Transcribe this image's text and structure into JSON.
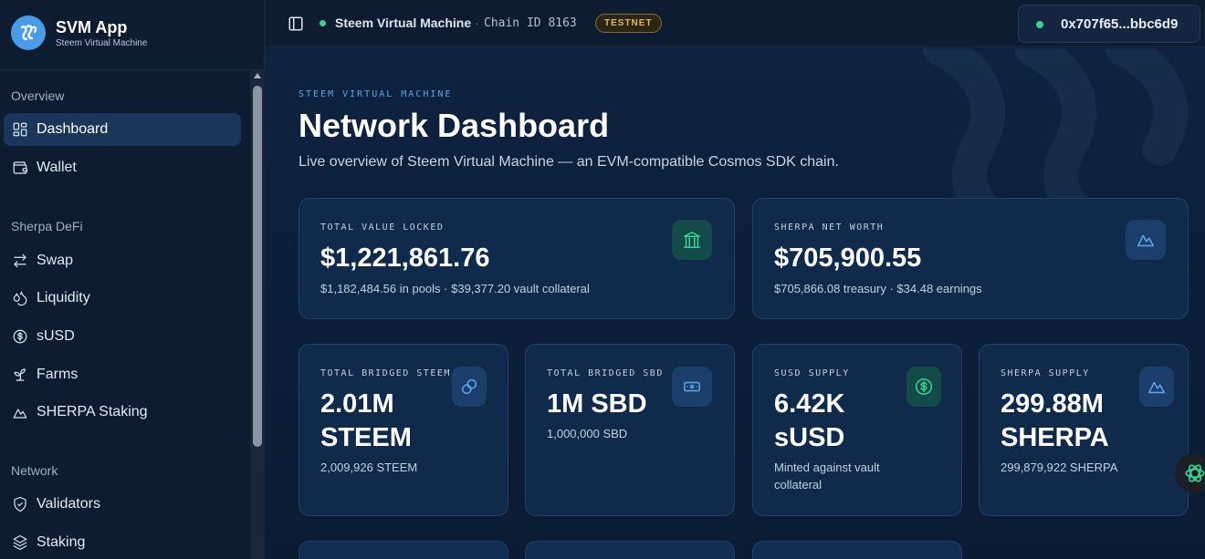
{
  "brand": {
    "title": "SVM App",
    "subtitle": "Steem Virtual Machine",
    "logo_icon": "steem-logo-icon"
  },
  "sidebar": {
    "sections": [
      {
        "label": "Overview"
      },
      {
        "label": "Sherpa DeFi"
      },
      {
        "label": "Network"
      }
    ],
    "items": [
      {
        "label": "Dashboard",
        "icon": "dashboard-icon",
        "active": true
      },
      {
        "label": "Wallet",
        "icon": "wallet-icon"
      },
      {
        "label": "Swap",
        "icon": "swap-icon"
      },
      {
        "label": "Liquidity",
        "icon": "droplets-icon"
      },
      {
        "label": "sUSD",
        "icon": "dollar-circle-icon"
      },
      {
        "label": "Farms",
        "icon": "sprout-icon"
      },
      {
        "label": "SHERPA Staking",
        "icon": "mountain-icon"
      },
      {
        "label": "Validators",
        "icon": "shield-icon"
      },
      {
        "label": "Staking",
        "icon": "layers-icon"
      }
    ]
  },
  "topbar": {
    "chain_name": "Steem Virtual Machine",
    "separator": "·",
    "chain_id": "Chain ID 8163",
    "badge": "TESTNET",
    "wallet_address": "0x707f65...bbc6d9"
  },
  "main": {
    "eyebrow": "STEEM VIRTUAL MACHINE",
    "title": "Network Dashboard",
    "description": "Live overview of Steem Virtual Machine — an EVM-compatible Cosmos SDK chain.",
    "cards": [
      {
        "label": "TOTAL VALUE LOCKED",
        "value": "$1,221,861.76",
        "sub": "$1,182,484.56 in pools · $39,377.20 vault collateral",
        "icon": "landmark-icon"
      },
      {
        "label": "SHERPA NET WORTH",
        "value": "$705,900.55",
        "sub": "$705,866.08 treasury · $34.48 earnings",
        "icon": "mountain-icon"
      },
      {
        "label": "TOTAL BRIDGED STEEM",
        "value_line1": "2.01M",
        "value_line2": "STEEM",
        "sub": "2,009,926 STEEM",
        "icon": "link-icon"
      },
      {
        "label": "TOTAL BRIDGED SBD",
        "value": "1M SBD",
        "sub": "1,000,000 SBD",
        "icon": "banknote-icon"
      },
      {
        "label": "SUSD SUPPLY",
        "value_line1": "6.42K",
        "value_line2": "sUSD",
        "sub_line1": "Minted against vault",
        "sub_line2": "collateral",
        "icon": "dollar-circle-icon"
      },
      {
        "label": "SHERPA SUPPLY",
        "value_line1": "299.88M",
        "value_line2": "SHERPA",
        "sub": "299,879,922 SHERPA",
        "icon": "mountain-icon"
      }
    ]
  },
  "colors": {
    "accent_blue": "#4a9be8",
    "accent_green": "#3ccf8e",
    "badge_gold": "#e0b75a",
    "background": "#0b1a2e"
  }
}
